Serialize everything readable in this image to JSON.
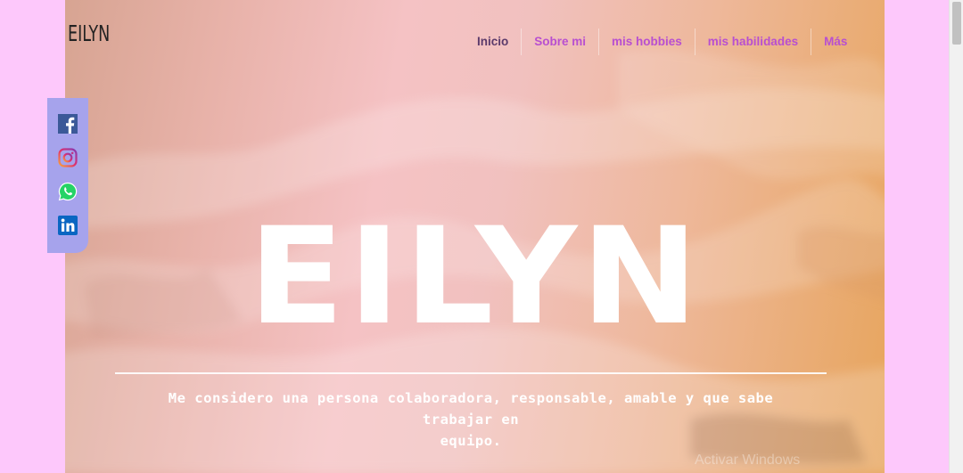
{
  "site": {
    "logo": "EILYN"
  },
  "nav": {
    "items": [
      {
        "label": "Inicio",
        "active": true
      },
      {
        "label": "Sobre mi",
        "active": false
      },
      {
        "label": "mis hobbies",
        "active": false
      },
      {
        "label": "mis habilidades",
        "active": false
      },
      {
        "label": "Más",
        "active": false
      }
    ]
  },
  "social": [
    {
      "icon": "facebook-icon",
      "color": "#3b5998"
    },
    {
      "icon": "instagram-icon",
      "color": "#c13584"
    },
    {
      "icon": "whatsapp-icon",
      "color": "#25d366"
    },
    {
      "icon": "linkedin-icon",
      "color": "#0a66c2"
    }
  ],
  "hero": {
    "title": "EILYN",
    "subtitle_line1": "Me considero una persona colaboradora, responsable, amable y que sabe trabajar en",
    "subtitle_line2": "equipo."
  },
  "watermark": "Activar Windows",
  "colors": {
    "background": "#fdc8fb",
    "nav_link": "#b84fd0",
    "nav_active": "#5b3a6b",
    "social_bar": "#a6a3ec"
  }
}
